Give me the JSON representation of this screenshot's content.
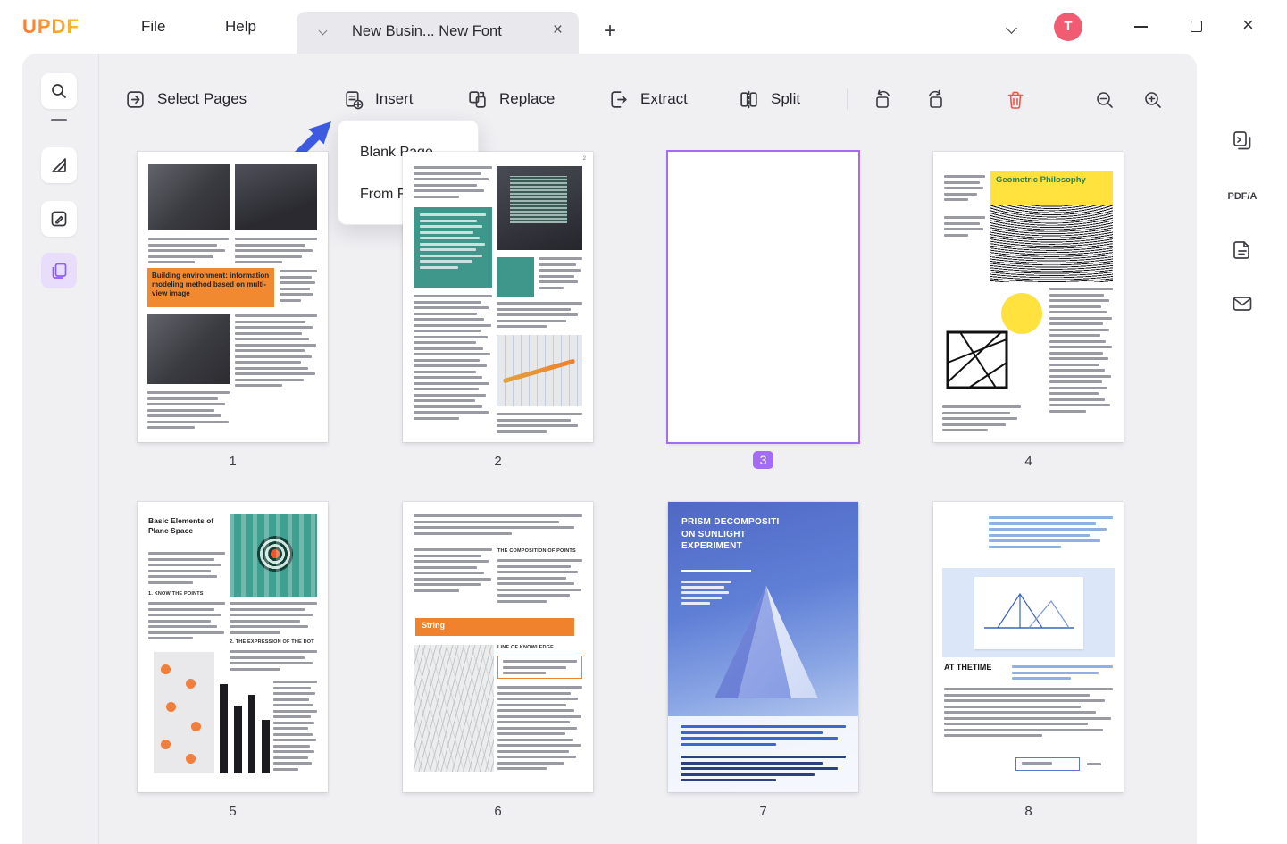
{
  "icons": {
    "close": "×",
    "plus": "+"
  },
  "app": {
    "logo": "UPDF",
    "menus": [
      {
        "label": "File"
      },
      {
        "label": "Help"
      }
    ],
    "tab": {
      "title": "New Busin... New Font"
    },
    "avatar": "T"
  },
  "toolbar": {
    "buttons": [
      {
        "label": "Select Pages"
      },
      {
        "label": "Insert"
      },
      {
        "label": "Replace"
      },
      {
        "label": "Extract"
      },
      {
        "label": "Split"
      }
    ]
  },
  "insert_menu": {
    "items": [
      {
        "label": "Blank Page..."
      },
      {
        "label": "From File..."
      }
    ]
  },
  "right_rail": {
    "pdfa_label": "PDF/A"
  },
  "pages": [
    {
      "number": "1",
      "headline": "Building environment: information modeling method based on multi-view image"
    },
    {
      "number": "2",
      "corner": "2"
    },
    {
      "number": "3",
      "selected": true
    },
    {
      "number": "4",
      "headline": "Geometric Philosophy"
    },
    {
      "number": "5",
      "headline": "Basic Elements of Plane Space",
      "sub1": "1. KNOW THE POINTS",
      "sub2": "2. THE EXPRESSION OF THE DOT"
    },
    {
      "number": "6",
      "sub1": "THE COMPOSITION OF POINTS",
      "banner": "String",
      "sub2": "LINE OF KNOWLEDGE"
    },
    {
      "number": "7",
      "headline": "PRISM DECOMPOSITI ON SUNLIGHT EXPERIMENT"
    },
    {
      "number": "8",
      "headline": "AT THETIME"
    }
  ],
  "colors": {
    "accent_purple": "#a46cf5",
    "accent_orange": "#f0822e",
    "danger_red": "#f05648",
    "arrow_blue": "#3c5be0"
  }
}
